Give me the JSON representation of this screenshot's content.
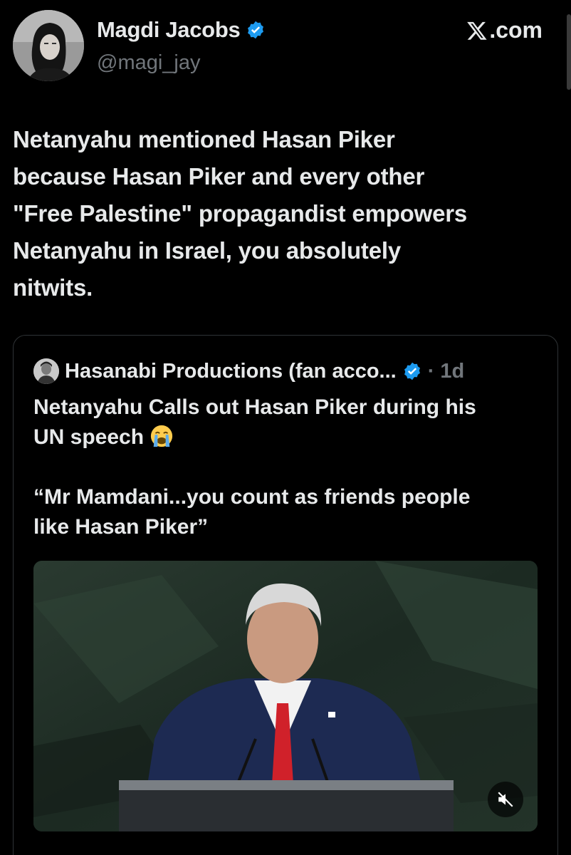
{
  "author": {
    "name": "Magdi Jacobs",
    "handle": "@magi_jay"
  },
  "brand": {
    "text": ".com"
  },
  "tweet": {
    "lines": [
      "Netanyahu mentioned Hasan Piker",
      "because Hasan Piker and every other",
      "\"Free Palestine\" propagandist empowers",
      "Netanyahu in Israel, you absolutely",
      "nitwits."
    ]
  },
  "quote": {
    "author": "Hasanabi Productions (fan acco...",
    "meta": "· 1d",
    "title_line1": "Netanyahu Calls out Hasan Piker during his",
    "title_line2": "UN speech",
    "quote_line1": "“Mr Mamdani...you count as friends people",
    "quote_line2": "like Hasan Piker”"
  },
  "colors": {
    "background": "#000000",
    "text": "#e7e9ea",
    "muted": "#71767b",
    "verified": "#1d9bf0",
    "border": "#2f3336",
    "tie": "#d0212a"
  },
  "icons": {
    "verified": "verified-badge-icon",
    "brand": "x-logo-icon",
    "emoji": "loudly-crying-face-icon",
    "mute": "muted-speaker-icon"
  }
}
